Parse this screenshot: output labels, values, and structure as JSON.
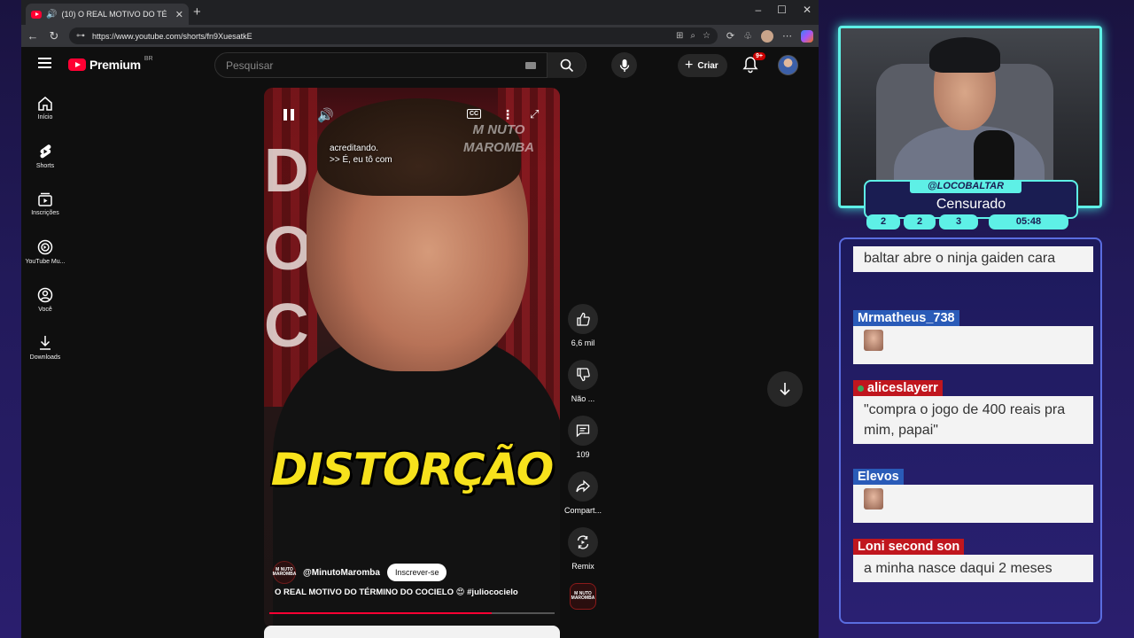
{
  "browser": {
    "tab_title": "(10) O REAL MOTIVO DO TÉ",
    "url": "https://www.youtube.com/shorts/fn9XuesatkE",
    "new_tab": "+",
    "win_controls": [
      "–",
      "☐",
      "✕"
    ]
  },
  "youtube": {
    "logo_text": "Premium",
    "logo_region": "BR",
    "search_placeholder": "Pesquisar",
    "create_label": "Criar",
    "notification_badge": "9+",
    "sidebar": [
      {
        "label": "Início",
        "icon": "home-icon"
      },
      {
        "label": "Shorts",
        "icon": "shorts-icon"
      },
      {
        "label": "Inscrições",
        "icon": "subscriptions-icon"
      },
      {
        "label": "YouTube Mu...",
        "icon": "youtube-music-icon"
      },
      {
        "label": "Você",
        "icon": "you-icon"
      },
      {
        "label": "Downloads",
        "icon": "downloads-icon"
      }
    ],
    "short": {
      "subtitle_line1": "acreditando.",
      "subtitle_line2": ">> É, eu tô com",
      "watermark_line1": "M NUTO",
      "watermark_line2": "MAROMBA",
      "caption": "DISTORÇÃO",
      "channel": "@MinutoMaromba",
      "channel_logo": "M NUTO MAROMBA",
      "subscribe_label": "Inscrever-se",
      "title": "O REAL MOTIVO DO TÉRMINO DO COCIELO 😍 #juliococielo",
      "progress": 0.78
    },
    "actions": {
      "likes": "6,6 mil",
      "dislike": "Não ...",
      "comments": "109",
      "share": "Compart...",
      "remix": "Remix"
    }
  },
  "stream": {
    "handle": "@LOCOBALTAR",
    "status": "Censurado",
    "stats": [
      "2",
      "2",
      "3"
    ],
    "timer": "05:48"
  },
  "chat": [
    {
      "user": "",
      "text": "baltar abre o ninja gaiden cara",
      "color": "#ffffff"
    },
    {
      "user": "Mrmatheus_738",
      "text": "",
      "emote": true,
      "color": "#2a5bb8"
    },
    {
      "user": "aliceslayerr",
      "text": "\"compra o jogo de 400 reais pra mim, papai\"",
      "color": "#c0161e"
    },
    {
      "user": "Elevos",
      "text": "",
      "emote": true,
      "color": "#2a5bb8"
    },
    {
      "user": "Loni second son",
      "text": "a minha nasce daqui 2 meses",
      "color": "#c0161e"
    }
  ]
}
